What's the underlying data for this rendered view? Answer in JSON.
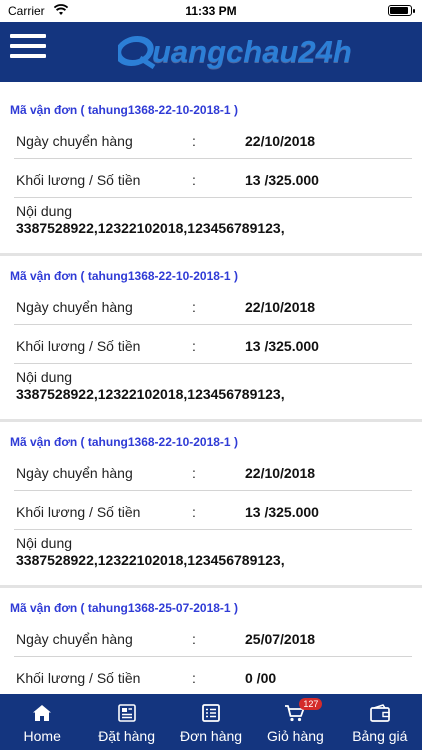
{
  "status_bar": {
    "carrier": "Carrier",
    "time": "11:33 PM"
  },
  "header": {
    "logo_text": "uangchau24h"
  },
  "orders": [
    {
      "code": "Mã vận đơn ( tahung1368-22-10-2018-1 )",
      "rows": [
        {
          "label": "Ngày chuyển hàng",
          "colon": ":",
          "value": "22/10/2018"
        },
        {
          "label": "Khối lương / Số tiền",
          "colon": ":",
          "value": "13 /325.000"
        }
      ],
      "content_label": "Nội dung",
      "content_value": "3387528922,12322102018,123456789123,"
    },
    {
      "code": "Mã vận đơn ( tahung1368-22-10-2018-1 )",
      "rows": [
        {
          "label": "Ngày chuyển hàng",
          "colon": ":",
          "value": "22/10/2018"
        },
        {
          "label": "Khối lương / Số tiền",
          "colon": ":",
          "value": "13 /325.000"
        }
      ],
      "content_label": "Nội dung",
      "content_value": "3387528922,12322102018,123456789123,"
    },
    {
      "code": "Mã vận đơn ( tahung1368-22-10-2018-1 )",
      "rows": [
        {
          "label": "Ngày chuyển hàng",
          "colon": ":",
          "value": "22/10/2018"
        },
        {
          "label": "Khối lương / Số tiền",
          "colon": ":",
          "value": "13 /325.000"
        }
      ],
      "content_label": "Nội dung",
      "content_value": "3387528922,12322102018,123456789123,"
    },
    {
      "code": "Mã vận đơn ( tahung1368-25-07-2018-1 )",
      "rows": [
        {
          "label": "Ngày chuyển hàng",
          "colon": ":",
          "value": "25/07/2018"
        },
        {
          "label": "Khối lương / Số tiền",
          "colon": ":",
          "value": "0 /00"
        }
      ],
      "content_label": "",
      "content_value": ""
    }
  ],
  "bottom_nav": {
    "items": [
      {
        "label": "Home",
        "icon": "home-icon"
      },
      {
        "label": "Đặt hàng",
        "icon": "order-form-icon"
      },
      {
        "label": "Đơn hàng",
        "icon": "orders-list-icon"
      },
      {
        "label": "Giỏ hàng",
        "icon": "cart-icon",
        "badge": "127"
      },
      {
        "label": "Bảng giá",
        "icon": "price-wallet-icon"
      }
    ]
  },
  "colors": {
    "brand": "#14357f",
    "order_code": "#2f3bd6",
    "badge": "#d42b2b"
  }
}
